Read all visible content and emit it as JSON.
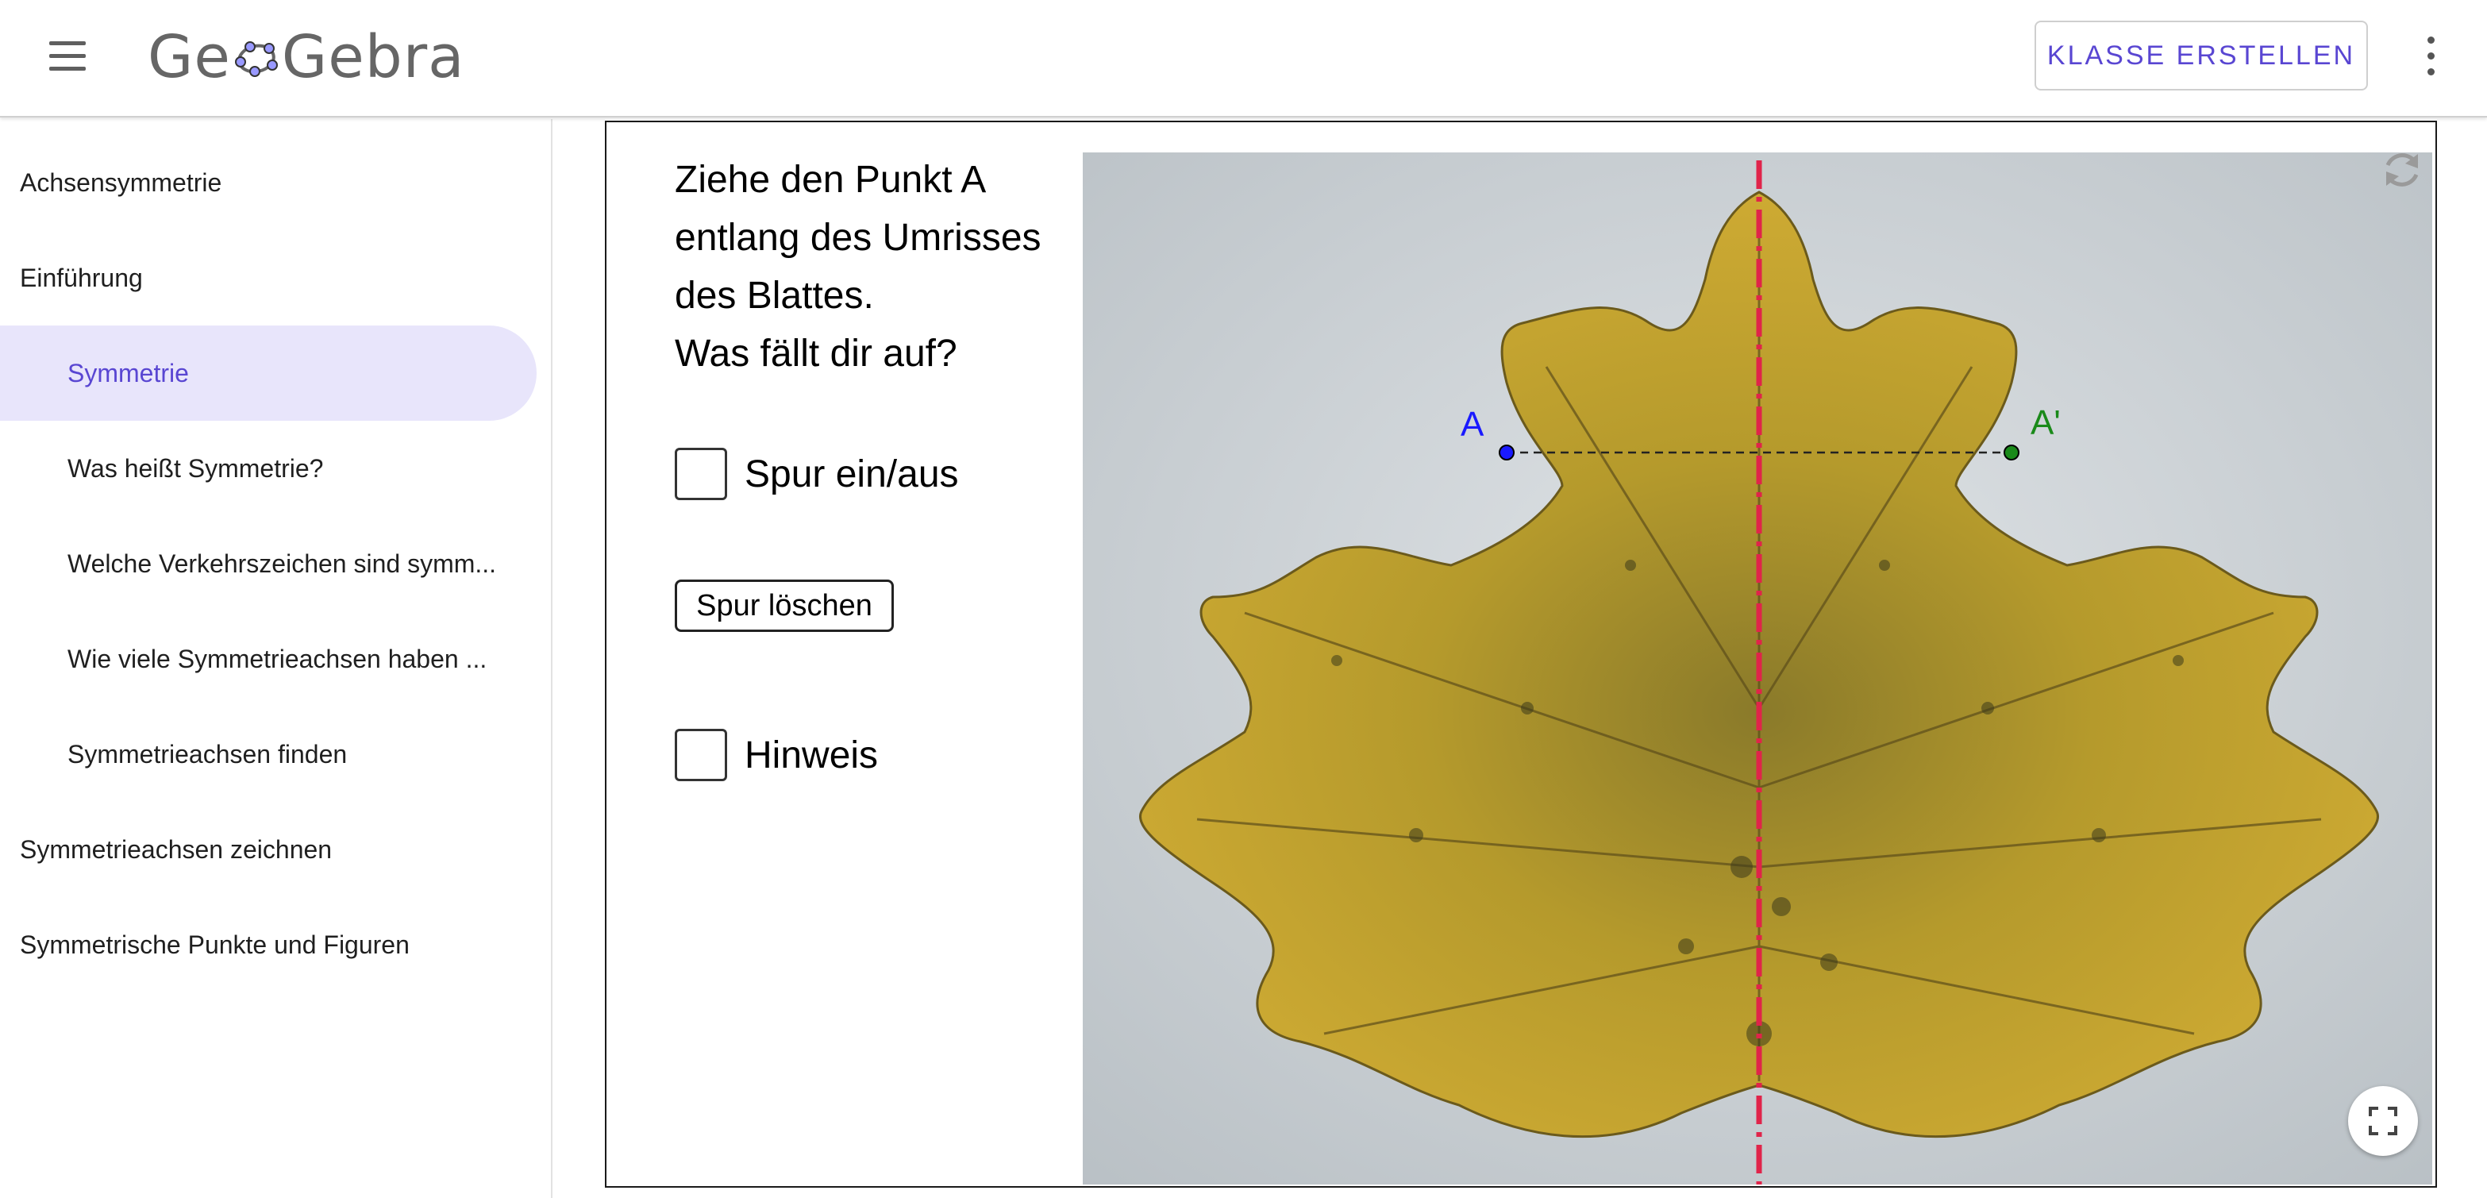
{
  "header": {
    "logo": "GeoGebra",
    "create_class_label": "KLASSE ERSTELLEN"
  },
  "sidebar": {
    "items": [
      {
        "label": "Achsensymmetrie",
        "level": 0,
        "active": false
      },
      {
        "label": "Einführung",
        "level": 0,
        "active": false
      },
      {
        "label": "Symmetrie",
        "level": 1,
        "active": true
      },
      {
        "label": "Was heißt Symmetrie?",
        "level": 1,
        "active": false
      },
      {
        "label": "Welche Verkehrszeichen sind symm...",
        "level": 1,
        "active": false
      },
      {
        "label": "Wie viele Symmetrieachsen haben ...",
        "level": 1,
        "active": false
      },
      {
        "label": "Symmetrieachsen finden",
        "level": 1,
        "active": false
      },
      {
        "label": "Symmetrieachsen zeichnen",
        "level": 0,
        "active": false
      },
      {
        "label": "Symmetrische Punkte und Figuren",
        "level": 0,
        "active": false
      }
    ]
  },
  "applet": {
    "instructions": [
      "Ziehe den Punkt A",
      "entlang des Umrisses",
      "des Blattes.",
      "Was fällt dir auf?"
    ],
    "checkbox_trace_label": "Spur ein/aus",
    "checkbox_trace_checked": false,
    "clear_trace_label": "Spur löschen",
    "checkbox_hint_label": "Hinweis",
    "checkbox_hint_checked": false,
    "point_a_label": "A",
    "point_a_prime_label": "A'",
    "colors": {
      "accent": "#5946d2",
      "active_bg": "#e8e5fb",
      "point_a": "#1a1aff",
      "point_a_prime": "#1a8a1a",
      "axis": "#e0244a",
      "leaf": "#c9a533"
    }
  }
}
